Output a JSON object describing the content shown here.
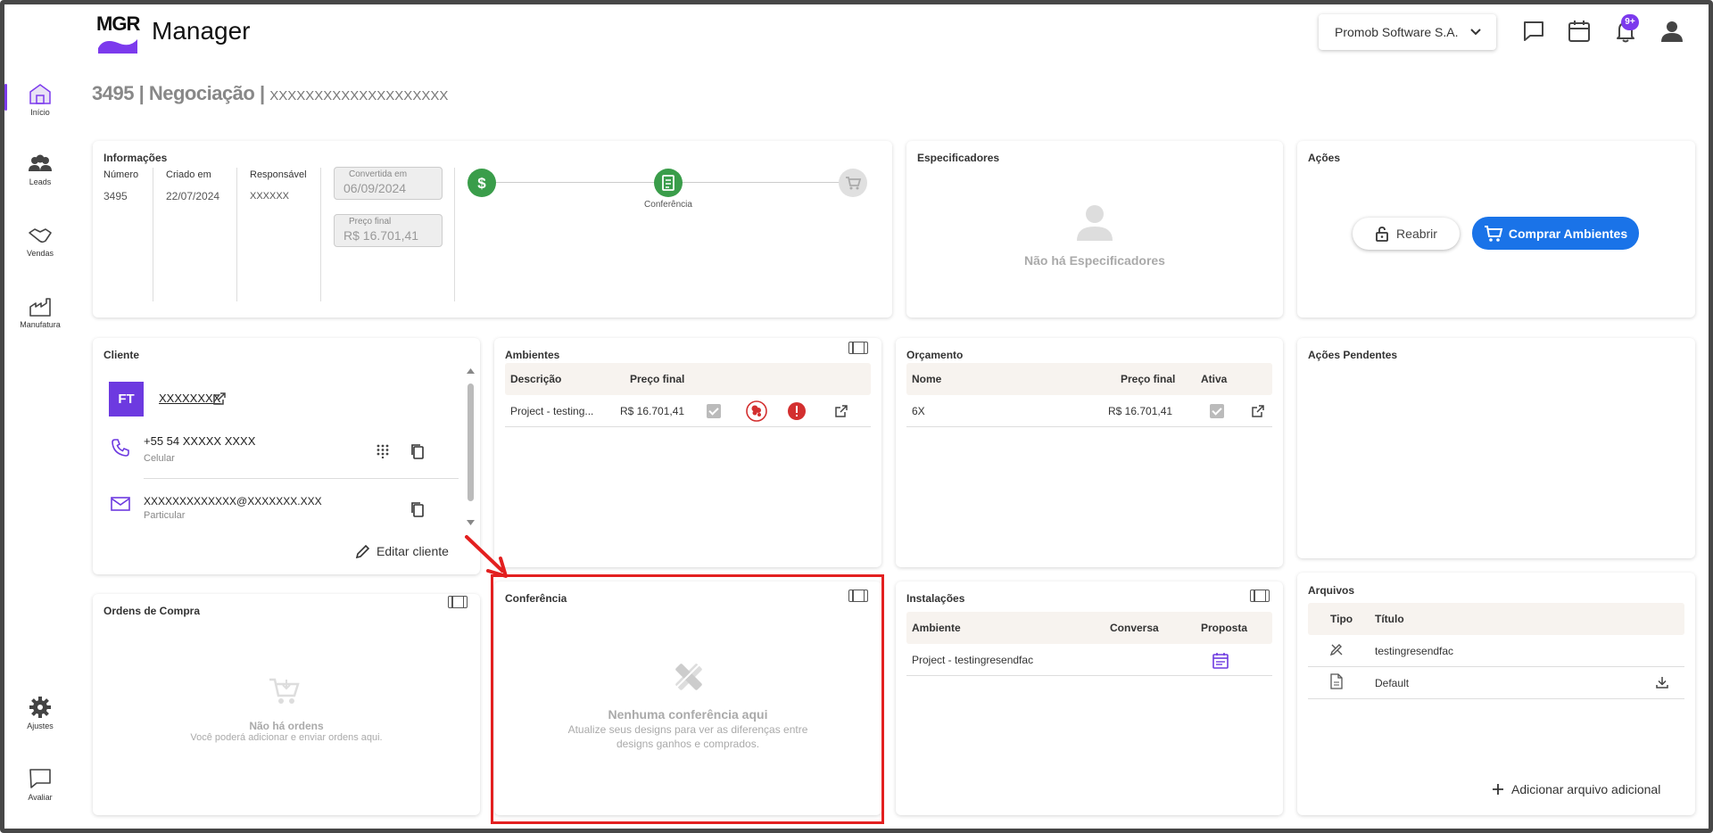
{
  "app": {
    "logo_text": "MGR",
    "title": "Manager"
  },
  "header": {
    "company": "Promob Software S.A.",
    "notification_badge": "9+"
  },
  "sidebar": [
    {
      "label": "Início",
      "icon": "home-icon"
    },
    {
      "label": "Leads",
      "icon": "people-icon"
    },
    {
      "label": "Vendas",
      "icon": "handshake-icon"
    },
    {
      "label": "Manufatura",
      "icon": "factory-icon"
    },
    {
      "label": "Ajustes",
      "icon": "gear-icon"
    },
    {
      "label": "Avaliar",
      "icon": "chat-icon"
    }
  ],
  "page": {
    "number": "3495",
    "stage": "Negociação",
    "subtitle": "XXXXXXXXXXXXXXXXXXXX"
  },
  "info": {
    "title": "Informações",
    "numero_label": "Número",
    "numero": "3495",
    "criado_label": "Criado em",
    "criado": "22/07/2024",
    "responsavel_label": "Responsável",
    "responsavel": "XXXXXX",
    "convertida_label": "Convertida em",
    "convertida": "06/09/2024",
    "preco_label": "Preço final",
    "preco": "R$ 16.701,41",
    "step_label": "Conferência"
  },
  "especificadores": {
    "title": "Especificadores",
    "empty": "Não há Especificadores"
  },
  "acoes": {
    "title": "Ações",
    "reabrir": "Reabrir",
    "comprar": "Comprar Ambientes"
  },
  "cliente": {
    "title": "Cliente",
    "initials": "FT",
    "name": "XXXXXXXX",
    "phone": "+55 54 XXXXX XXXX",
    "phone_type": "Celular",
    "email": "XXXXXXXXXXXXX@XXXXXXX.XXX",
    "email_type": "Particular",
    "edit": "Editar cliente"
  },
  "ambientes": {
    "title": "Ambientes",
    "col_desc": "Descrição",
    "col_preco": "Preço final",
    "rows": [
      {
        "desc": "Project - testing...",
        "preco": "R$ 16.701,41"
      }
    ]
  },
  "orcamento": {
    "title": "Orçamento",
    "col_nome": "Nome",
    "col_preco": "Preço final",
    "col_ativa": "Ativa",
    "rows": [
      {
        "nome": "6X",
        "preco": "R$ 16.701,41"
      }
    ]
  },
  "acoes_pendentes": {
    "title": "Ações Pendentes"
  },
  "ordens": {
    "title": "Ordens de Compra",
    "empty": "Não há ordens",
    "empty_sub": "Você poderá adicionar e enviar ordens aqui."
  },
  "conferencia": {
    "title": "Conferência",
    "empty": "Nenhuma conferência aqui",
    "empty_sub1": "Atualize seus designs para ver as diferenças entre",
    "empty_sub2": "designs ganhos e comprados."
  },
  "instalacoes": {
    "title": "Instalações",
    "col_ambiente": "Ambiente",
    "col_conversa": "Conversa",
    "col_proposta": "Proposta",
    "rows": [
      {
        "ambiente": "Project - testingresendfac"
      }
    ]
  },
  "arquivos": {
    "title": "Arquivos",
    "col_tipo": "Tipo",
    "col_titulo": "Título",
    "rows": [
      {
        "titulo": "testingresendfac"
      },
      {
        "titulo": "Default"
      }
    ],
    "add": "Adicionar arquivo adicional"
  },
  "colors": {
    "accent": "#7c3aed",
    "primary": "#1a73e8",
    "success": "#3a9d4a",
    "danger": "#d32f2f",
    "highlight": "#e32020"
  }
}
